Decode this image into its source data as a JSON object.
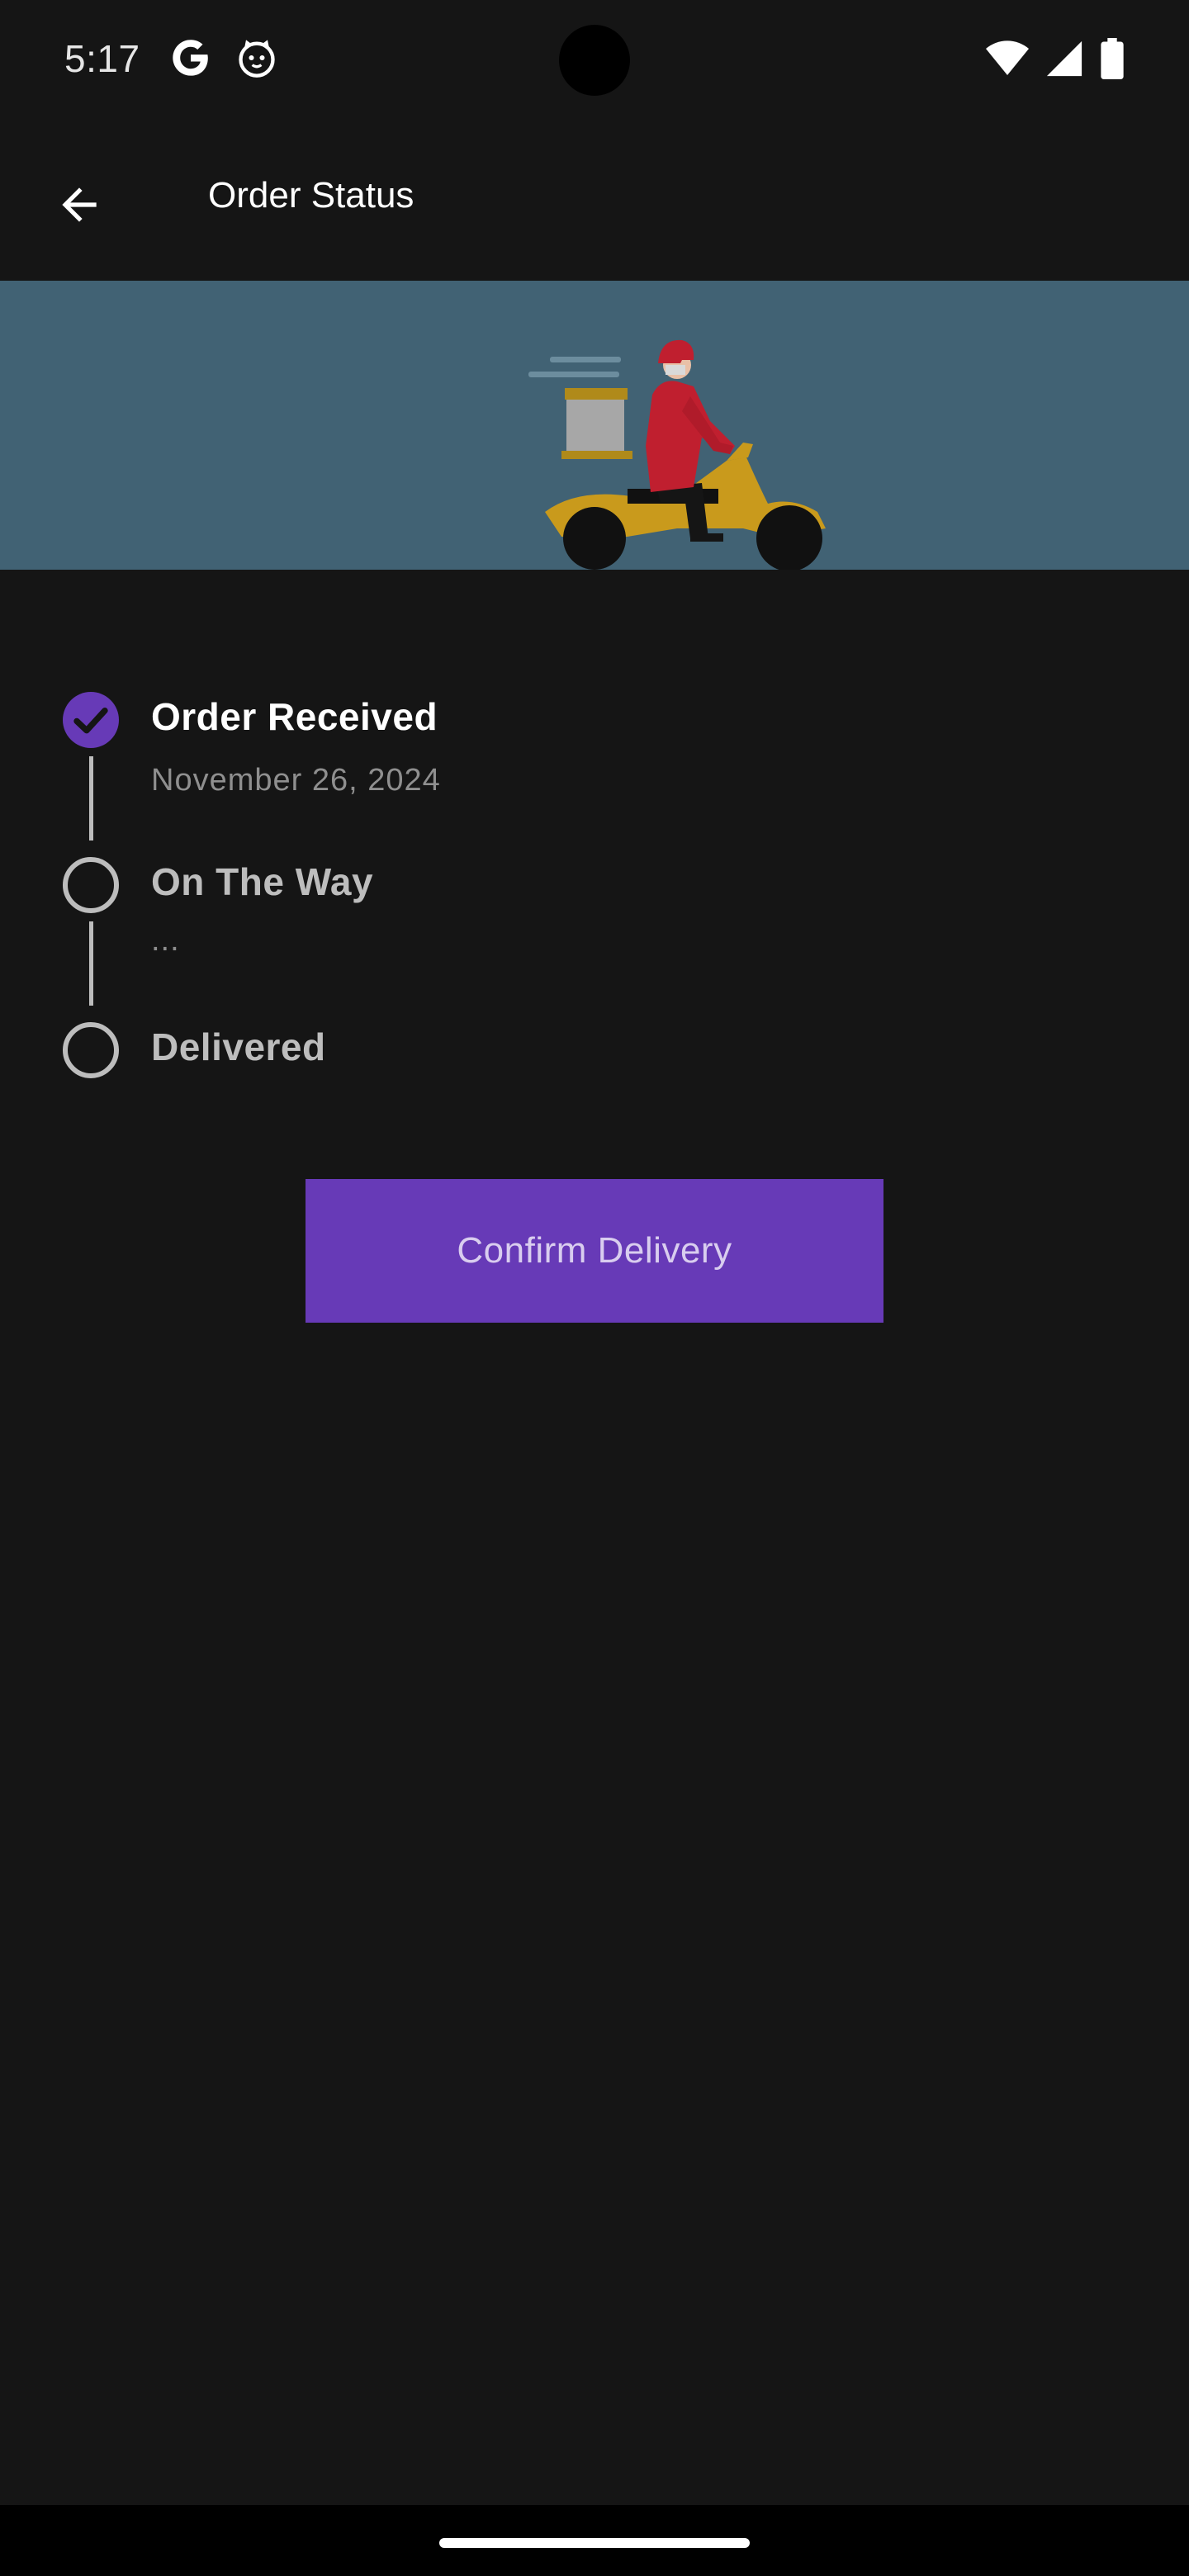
{
  "status_bar": {
    "time": "5:17",
    "left_icons": [
      "google-icon",
      "cat-face-icon"
    ],
    "right_icons": [
      "wifi-icon",
      "cellular-signal-icon",
      "battery-icon"
    ]
  },
  "app_bar": {
    "back_icon": "arrow-back-icon",
    "title": "Order Status"
  },
  "hero": {
    "illustration": "delivery-rider-scooter",
    "background_color": "#416274"
  },
  "timeline": {
    "steps": [
      {
        "title": "Order Received",
        "subtitle": "November 26, 2024",
        "state": "done"
      },
      {
        "title": "On The Way",
        "subtitle": "...",
        "state": "pending"
      },
      {
        "title": "Delivered",
        "subtitle": "",
        "state": "pending"
      }
    ],
    "accent_color": "#673ab7"
  },
  "actions": {
    "confirm_label": "Confirm Delivery"
  }
}
